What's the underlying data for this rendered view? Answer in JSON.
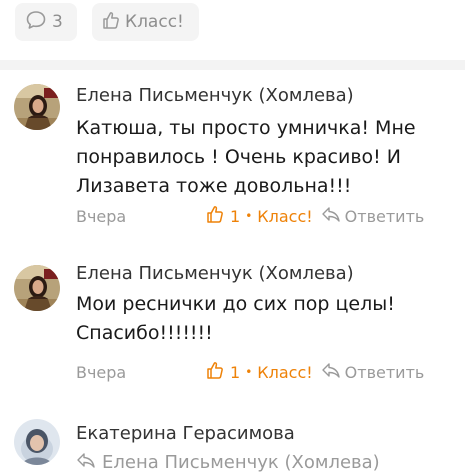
{
  "top_actions": {
    "comments_count": "3",
    "klass_label": "Класс!"
  },
  "comments": [
    {
      "author": "Елена Письменчук (Хомлева)",
      "text_lines": [
        "Катюша, ты просто умничка! Мне",
        "понравилось ! Очень красиво! И",
        "Лизавета тоже довольна!!!"
      ],
      "date": "Вчера",
      "likes": "1",
      "klass_label": "Класс!",
      "reply_label": "Ответить"
    },
    {
      "author": "Елена Письменчук (Хомлева)",
      "text_lines": [
        "Мои реснички  до сих пор целы!",
        "Спасибо!!!!!!!"
      ],
      "date": "Вчера",
      "likes": "1",
      "klass_label": "Класс!",
      "reply_label": "Ответить"
    },
    {
      "author": "Екатерина Герасимова",
      "reply_to": "Елена Письменчук (Хомлева)"
    }
  ],
  "colors": {
    "accent": "#ee8208",
    "muted": "#9a9a9a",
    "pill_bg": "#f4f4f4",
    "divider": "#f3f3f3"
  },
  "icons": {
    "comments": "speech-bubble-icon",
    "klass": "thumbs-up-icon",
    "reply": "reply-arrow-icon"
  }
}
